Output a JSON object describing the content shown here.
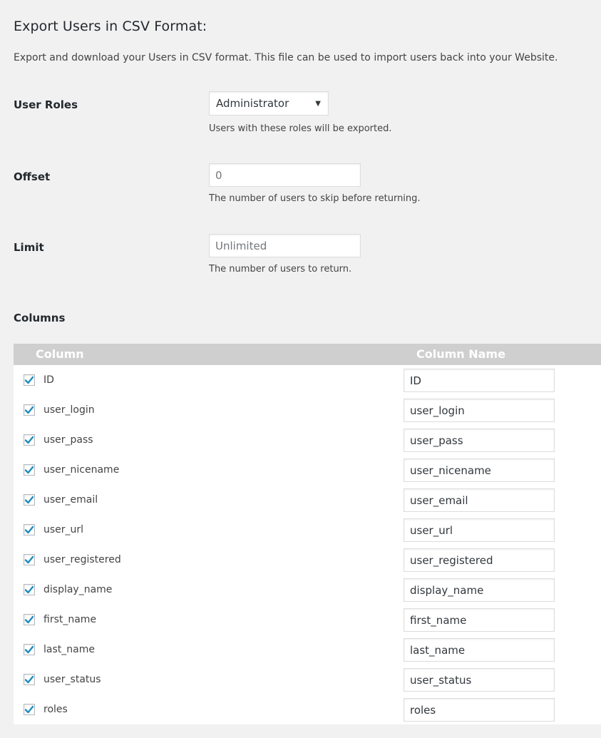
{
  "page": {
    "title": "Export Users in CSV Format:",
    "description": "Export and download your Users in CSV format. This file can be used to import users back into your Website."
  },
  "fields": {
    "user_roles": {
      "label": "User Roles",
      "selected": "Administrator",
      "help": "Users with these roles will be exported."
    },
    "offset": {
      "label": "Offset",
      "placeholder": "0",
      "help": "The number of users to skip before returning."
    },
    "limit": {
      "label": "Limit",
      "placeholder": "Unlimited",
      "help": "The number of users to return."
    }
  },
  "columns": {
    "label": "Columns",
    "header_column": "Column",
    "header_column_name": "Column Name",
    "rows": [
      {
        "column": "ID",
        "name": "ID",
        "checked": true
      },
      {
        "column": "user_login",
        "name": "user_login",
        "checked": true
      },
      {
        "column": "user_pass",
        "name": "user_pass",
        "checked": true
      },
      {
        "column": "user_nicename",
        "name": "user_nicename",
        "checked": true
      },
      {
        "column": "user_email",
        "name": "user_email",
        "checked": true
      },
      {
        "column": "user_url",
        "name": "user_url",
        "checked": true
      },
      {
        "column": "user_registered",
        "name": "user_registered",
        "checked": true
      },
      {
        "column": "display_name",
        "name": "display_name",
        "checked": true
      },
      {
        "column": "first_name",
        "name": "first_name",
        "checked": true
      },
      {
        "column": "last_name",
        "name": "last_name",
        "checked": true
      },
      {
        "column": "user_status",
        "name": "user_status",
        "checked": true
      },
      {
        "column": "roles",
        "name": "roles",
        "checked": true
      }
    ]
  },
  "colors": {
    "accent": "#1e8cbe",
    "header_bg": "#cfcfcf",
    "page_bg": "#f1f1f1"
  },
  "icons": {
    "checkbox": "checkmark-icon",
    "select": "caret-down-icon"
  }
}
